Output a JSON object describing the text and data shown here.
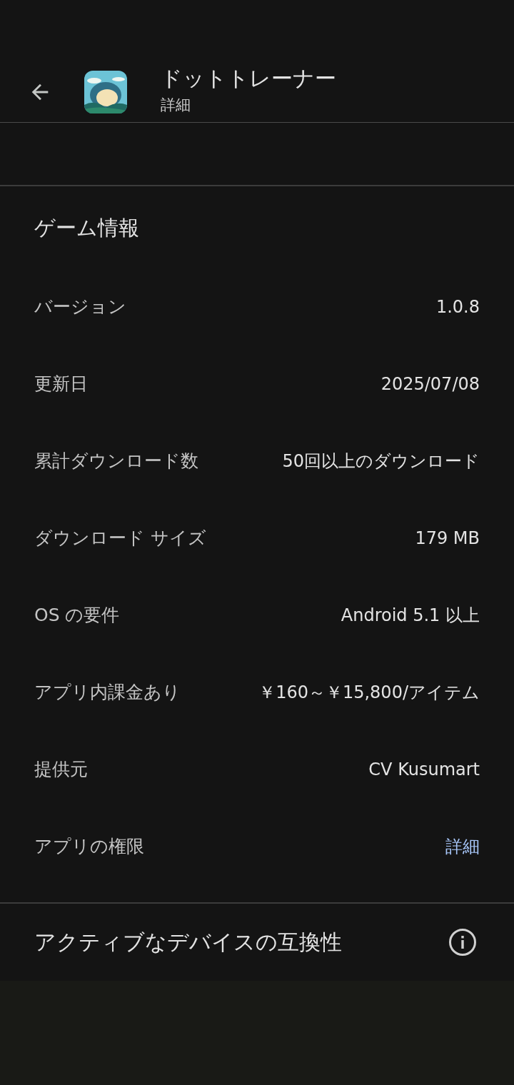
{
  "header": {
    "title": "ドットトレーナー",
    "subtitle": "詳細"
  },
  "section": {
    "title": "ゲーム情報",
    "rows": [
      {
        "label": "バージョン",
        "value": "1.0.8",
        "kind": "text"
      },
      {
        "label": "更新日",
        "value": "2025/07/08",
        "kind": "text"
      },
      {
        "label": "累計ダウンロード数",
        "value": "50回以上のダウンロード",
        "kind": "text"
      },
      {
        "label": "ダウンロード サイズ",
        "value": "179 MB",
        "kind": "text"
      },
      {
        "label": "OS の要件",
        "value": "Android 5.1 以上",
        "kind": "text"
      },
      {
        "label": "アプリ内課金あり",
        "value": "￥160～￥15,800/アイテム",
        "kind": "text"
      },
      {
        "label": "提供元",
        "value": "CV Kusumart",
        "kind": "text"
      },
      {
        "label": "アプリの権限",
        "value": "詳細",
        "kind": "link"
      }
    ]
  },
  "compatibility": {
    "title": "アクティブなデバイスの互換性"
  }
}
